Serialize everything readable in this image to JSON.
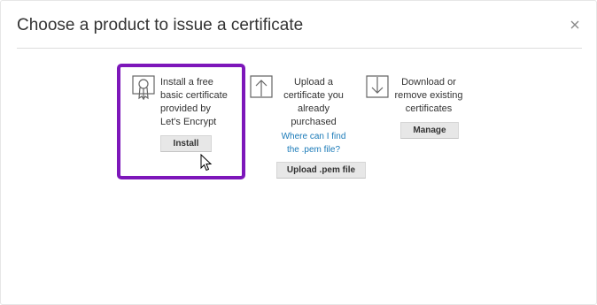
{
  "dialog": {
    "title": "Choose a product to issue a certificate",
    "close_glyph": "×"
  },
  "options": {
    "letsencrypt": {
      "icon": "certificate-ribbon-icon",
      "lines": [
        "Install a free",
        "basic certificate",
        "provided by",
        "Let's Encrypt"
      ],
      "button": "Install"
    },
    "upload": {
      "icon": "upload-arrow-icon",
      "lines": [
        "Upload a",
        "certificate you",
        "already",
        "purchased"
      ],
      "link_lines": [
        "Where can I find",
        "the .pem file?"
      ],
      "button": "Upload .pem file"
    },
    "manage": {
      "icon": "download-arrow-icon",
      "lines": [
        "Download or",
        "remove existing",
        "certificates"
      ],
      "button": "Manage"
    }
  },
  "colors": {
    "highlight": "#7d17ba",
    "link": "#1a7ab8"
  }
}
